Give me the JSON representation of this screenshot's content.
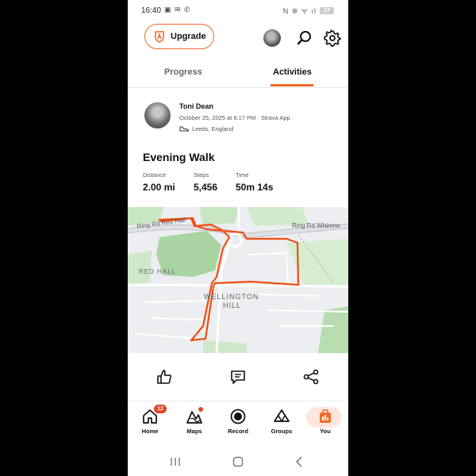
{
  "status_bar": {
    "time": "16:40",
    "left_icons": "▣ ✉ ✆",
    "right_icons": "N ✲ ᯤ ıl",
    "battery": "17"
  },
  "header": {
    "upgrade_label": "Upgrade"
  },
  "tabs": [
    {
      "label": "Progress",
      "active": false
    },
    {
      "label": "Activities",
      "active": true
    }
  ],
  "activity": {
    "athlete_name": "Toni Dean",
    "meta": "October 25, 2025 at 6:17 PM · Strava App",
    "location": "Leeds, England",
    "title": "Evening Walk",
    "stats": [
      {
        "label": "Distance",
        "value": "2.00 mi"
      },
      {
        "label": "Steps",
        "value": "5,456"
      },
      {
        "label": "Time",
        "value": "50m 14s"
      }
    ]
  },
  "map": {
    "labels": {
      "ring_rd_red_hall": "Ring Rd Red Hall",
      "ring_rd_whinmoor": "Ring Rd Whinmo",
      "red_hall": "RED HALL",
      "wellington_hill": "WELLINGTON",
      "wellington_hill_2": "HILL"
    },
    "route_color": "#f24d14"
  },
  "bottom_nav": {
    "home": "Home",
    "maps": "Maps",
    "record": "Record",
    "groups": "Groups",
    "you": "You",
    "home_badge": "12"
  },
  "colors": {
    "accent": "#f06a2a",
    "badge": "#e8442b"
  }
}
